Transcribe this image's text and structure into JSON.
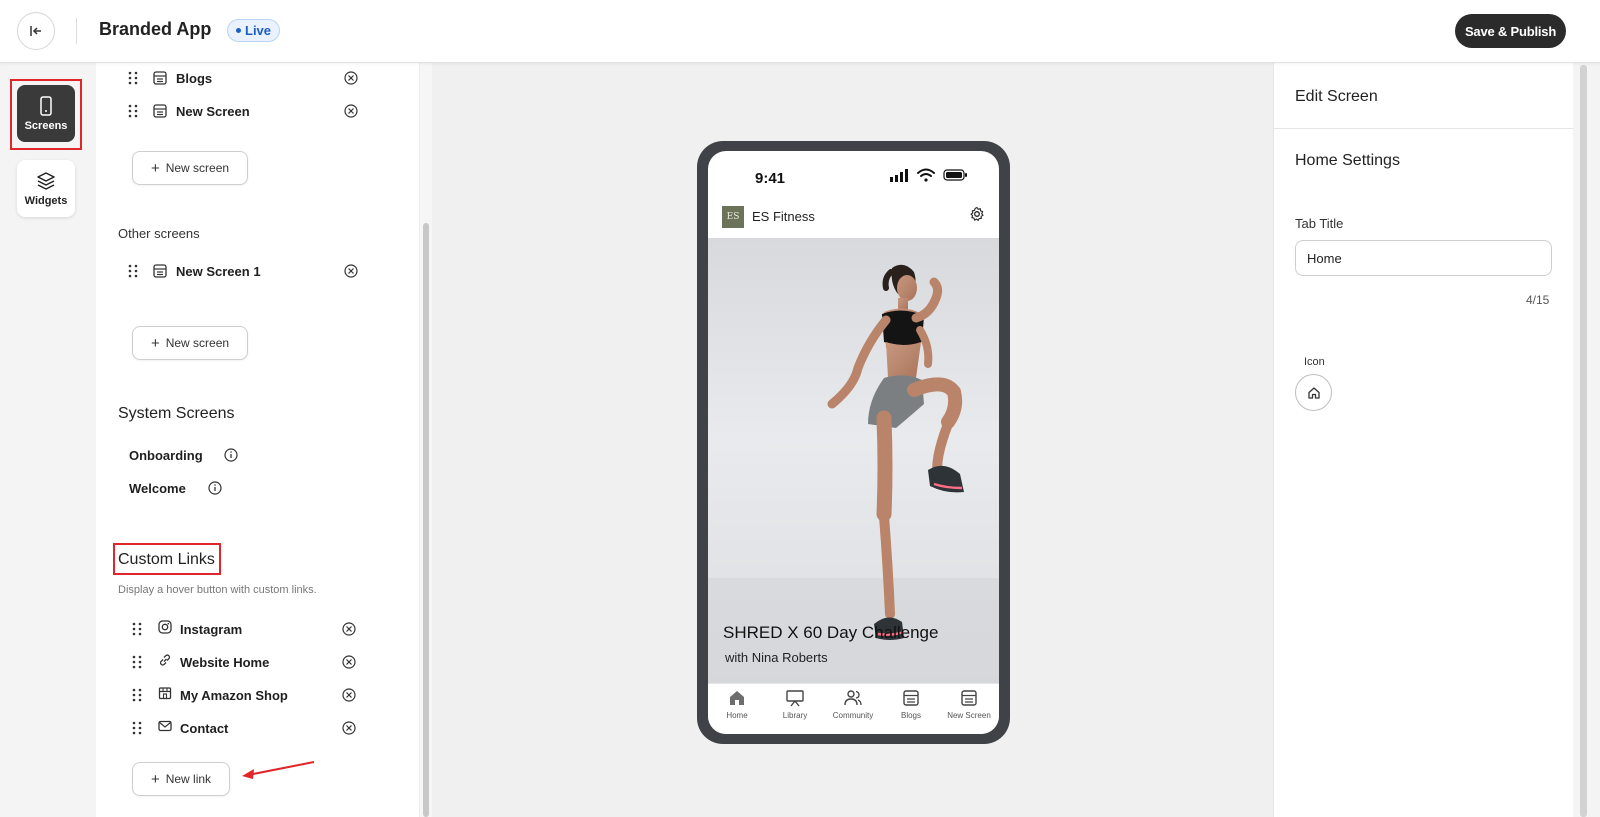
{
  "header": {
    "app_title": "Branded App",
    "status_badge": "Live",
    "publish_label": "Save & Publish"
  },
  "rail": {
    "screens_label": "Screens",
    "widgets_label": "Widgets"
  },
  "panel": {
    "main_screens": [
      {
        "label": "Blogs"
      },
      {
        "label": "New Screen"
      }
    ],
    "new_screen_label": "New screen",
    "other_screens_heading": "Other screens",
    "other_screens": [
      {
        "label": "New Screen 1"
      }
    ],
    "new_screen_label_2": "New screen",
    "system_heading": "System Screens",
    "system_screens": [
      {
        "label": "Onboarding"
      },
      {
        "label": "Welcome"
      }
    ],
    "custom_links_heading": "Custom Links",
    "custom_links_helper": "Display a hover button with custom links.",
    "custom_links": [
      {
        "label": "Instagram",
        "icon": "instagram-icon"
      },
      {
        "label": "Website Home",
        "icon": "link-icon"
      },
      {
        "label": "My Amazon Shop",
        "icon": "shop-icon"
      },
      {
        "label": "Contact",
        "icon": "mail-icon"
      }
    ],
    "new_link_label": "New link"
  },
  "phone": {
    "time": "9:41",
    "logo_text": "ES",
    "app_name": "ES Fitness",
    "hero_title": "SHRED X 60 Day Challenge",
    "hero_subtitle": "with Nina Roberts",
    "tabs": [
      {
        "label": "Home",
        "icon": "home-icon"
      },
      {
        "label": "Library",
        "icon": "presentation-icon"
      },
      {
        "label": "Community",
        "icon": "users-icon"
      },
      {
        "label": "Blogs",
        "icon": "document-icon"
      },
      {
        "label": "New Screen",
        "icon": "document-icon"
      }
    ]
  },
  "edit": {
    "title": "Edit Screen",
    "subtitle": "Home Settings",
    "tab_title_label": "Tab Title",
    "tab_title_value": "Home",
    "char_count": "4/15",
    "icon_label": "Icon"
  },
  "colors": {
    "accent_dark": "#2b2b2b",
    "live_blue": "#1d5fc4",
    "highlight_red": "#e0262b",
    "phone_frame": "#3f4347"
  }
}
